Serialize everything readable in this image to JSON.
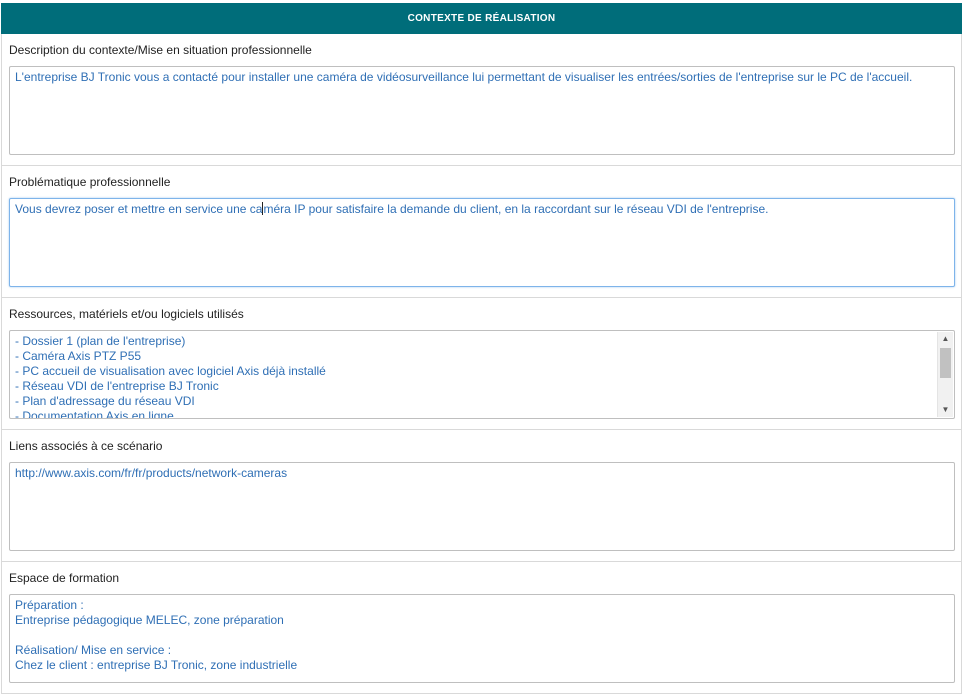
{
  "header": {
    "title": "CONTEXTE DE RÉALISATION"
  },
  "sections": {
    "description": {
      "label": "Description du contexte/Mise en situation professionnelle",
      "lines": [
        "L'entreprise BJ Tronic vous a contacté pour installer une caméra de vidéosurveillance lui permettant de visualiser les entrées/sorties de l'entreprise sur le PC de l'accueil."
      ]
    },
    "problematique": {
      "label": "Problématique professionnelle",
      "text_before_caret": "Vous devrez poser et mettre en service une ca",
      "text_after_caret": "méra IP pour satisfaire la demande du client, en la raccordant sur le réseau VDI de l'entreprise."
    },
    "ressources": {
      "label": "Ressources, matériels et/ou logiciels utilisés",
      "lines": [
        "- Dossier 1 (plan de l'entreprise)",
        "- Caméra Axis PTZ P55",
        "- PC accueil de visualisation avec logiciel Axis déjà installé",
        "- Réseau VDI de l'entreprise BJ Tronic",
        "- Plan d'adressage du réseau VDI",
        "- Documentation Axis en ligne"
      ]
    },
    "liens": {
      "label": "Liens associés à ce scénario",
      "lines": [
        "http://www.axis.com/fr/fr/products/network-cameras"
      ]
    },
    "espace": {
      "label": "Espace de formation",
      "lines": [
        "Préparation :",
        "Entreprise pédagogique MELEC, zone préparation",
        "",
        "Réalisation/ Mise en service :",
        "Chez le client : entreprise BJ Tronic, zone industrielle"
      ]
    }
  },
  "icons": {
    "scroll_up": "chevron-up-icon",
    "scroll_down": "chevron-down-icon"
  },
  "colors": {
    "header_bg": "#006d7a",
    "field_text": "#2f6fb5",
    "active_border": "#7eb4ea"
  }
}
